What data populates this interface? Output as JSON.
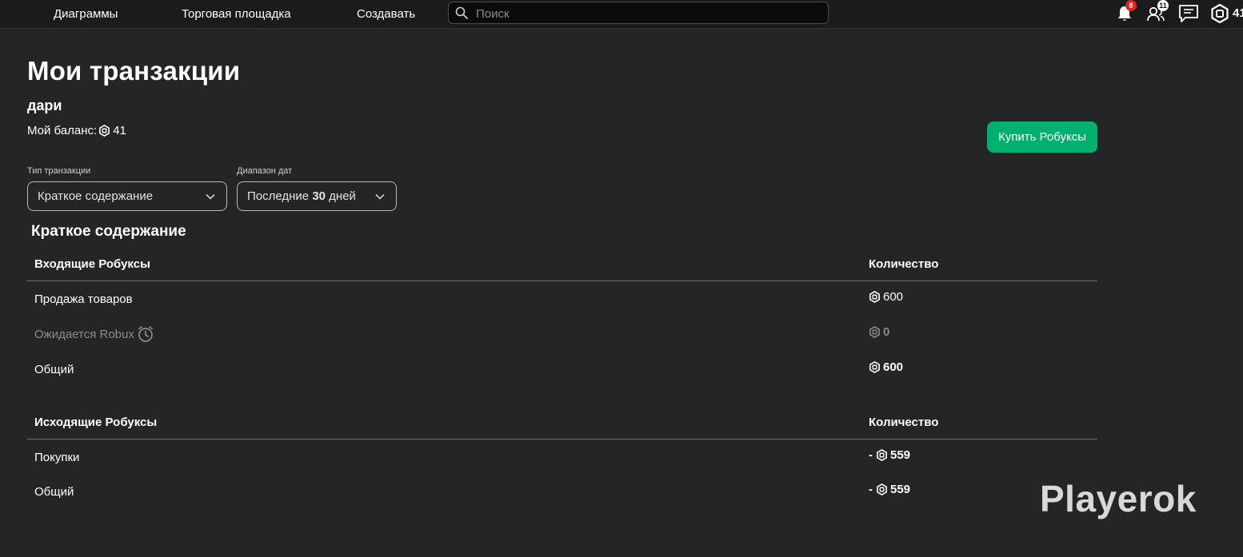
{
  "nav": {
    "links": [
      "Диаграммы",
      "Торговая площадка",
      "Создавать"
    ],
    "search_placeholder": "Поиск",
    "notifications_count": "8",
    "friends_count": "11",
    "robux_balance_short": "41"
  },
  "page": {
    "title": "Мои транзакции",
    "username": "дари",
    "balance_label": "Мой баланс:",
    "balance_value": "41",
    "buy_button": "Купить Робуксы"
  },
  "filters": {
    "type_label": "Тип транзакции",
    "type_value": "Краткое содержание",
    "date_label": "Диапазон дат",
    "date_value_prefix": "Последние ",
    "date_value_number": "30",
    "date_value_suffix": " дней"
  },
  "summary": {
    "title": "Краткое содержание",
    "incoming": {
      "header": "Входящие Робуксы",
      "amount_header": "Количество",
      "rows": [
        {
          "label": "Продажа товаров",
          "amount": "600"
        },
        {
          "label": "Ожидается Robux",
          "amount": "0"
        },
        {
          "label": "Общий",
          "amount": "600"
        }
      ]
    },
    "outgoing": {
      "header": "Исходящие Робуксы",
      "amount_header": "Количество",
      "rows": [
        {
          "label": "Покупки",
          "sign": "-",
          "amount": "559"
        },
        {
          "label": "Общий",
          "sign": "-",
          "amount": "559"
        }
      ]
    }
  },
  "watermark": "Playerok",
  "colors": {
    "background": "#232527",
    "topbar": "#191b1d",
    "accent_green": "#00b06f",
    "badge_red": "#e2231a",
    "muted_text": "#8a8c8e"
  }
}
